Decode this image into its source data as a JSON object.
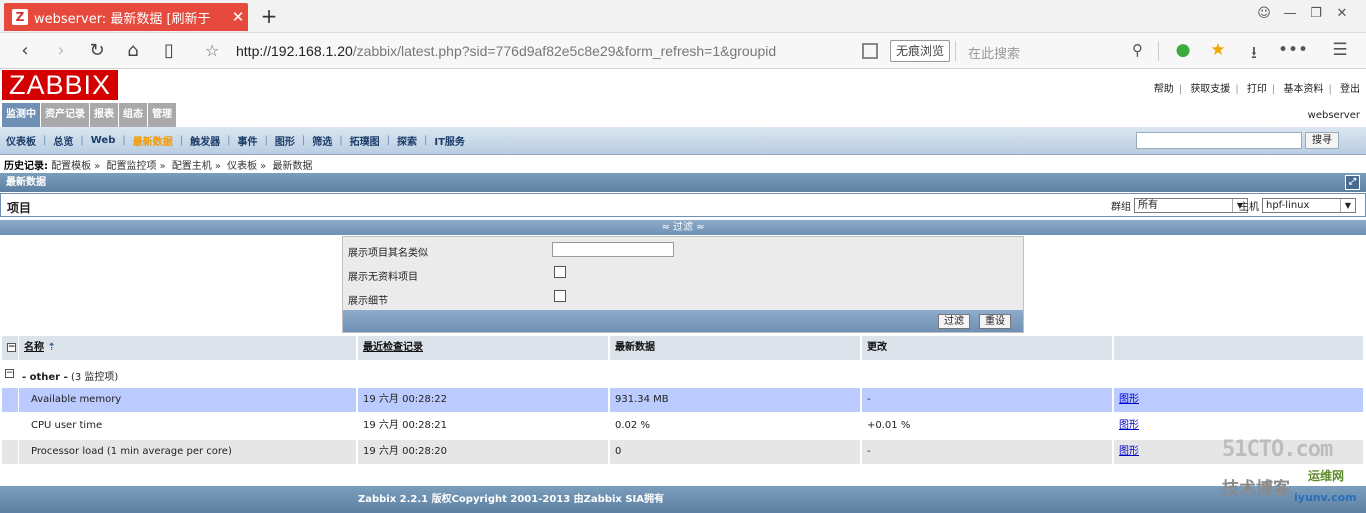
{
  "browser": {
    "tab_title": "webserver: 最新数据 [刷新于",
    "favicon_letter": "Z",
    "tab_close": "✕",
    "new_tab": "+",
    "url_host": "http://192.168.1.20",
    "url_rest": "/zabbix/latest.php?sid=776d9af82e5c8e29&form_refresh=1&groupid",
    "incognito_label": "无痕浏览",
    "search_placeholder": "在此搜索"
  },
  "header": {
    "logo": "ZABBIX",
    "links": [
      "帮助",
      "获取支援",
      "打印",
      "基本资料",
      "登出"
    ],
    "server_name": "webserver"
  },
  "main_menu": [
    {
      "label": "监测中",
      "active": true
    },
    {
      "label": "资产记录",
      "active": false
    },
    {
      "label": "报表",
      "active": false
    },
    {
      "label": "组态",
      "active": false
    },
    {
      "label": "管理",
      "active": false
    }
  ],
  "sub_menu": [
    {
      "label": "仪表板",
      "active": false
    },
    {
      "label": "总览",
      "active": false
    },
    {
      "label": "Web",
      "active": false
    },
    {
      "label": "最新数据",
      "active": true
    },
    {
      "label": "触发器",
      "active": false
    },
    {
      "label": "事件",
      "active": false
    },
    {
      "label": "图形",
      "active": false
    },
    {
      "label": "筛选",
      "active": false
    },
    {
      "label": "拓璞图",
      "active": false
    },
    {
      "label": "探索",
      "active": false
    },
    {
      "label": "IT服务",
      "active": false
    }
  ],
  "search_button": "搜寻",
  "history": {
    "label": "历史记录:",
    "items": [
      "配置模板",
      "配置监控项",
      "配置主机",
      "仪表板",
      "最新数据"
    ]
  },
  "section_title": "最新数据",
  "items_bar": {
    "title": "项目",
    "group_label": "群组",
    "group_value": "所有",
    "host_label": "主机",
    "host_value": "hpf-linux"
  },
  "filter": {
    "toggle": "≈ 过滤 ≈",
    "name_label": "展示项目其名类似",
    "no_data_label": "展示无资料项目",
    "details_label": "展示细节",
    "filter_button": "过滤",
    "reset_button": "重设"
  },
  "table": {
    "headers": [
      "名称",
      "最近检查记录",
      "最新数据",
      "更改",
      ""
    ],
    "group_label": "- other -",
    "group_count": "(3 监控项)",
    "rows": [
      {
        "name": "Available memory",
        "last_check": "19 六月 00:28:22",
        "last_value": "931.34 MB",
        "change": "-",
        "link": "图形"
      },
      {
        "name": "CPU user time",
        "last_check": "19 六月 00:28:21",
        "last_value": "0.02 %",
        "change": "+0.01 %",
        "link": "图形"
      },
      {
        "name": "Processor load (1 min average per core)",
        "last_check": "19 六月 00:28:20",
        "last_value": "0",
        "change": "-",
        "link": "图形"
      }
    ]
  },
  "footer": "Zabbix 2.2.1 版权Copyright 2001-2013 由Zabbix SIA拥有",
  "watermark": {
    "line1": "51CTO.com",
    "line2": "技术博客",
    "line3": "运维网",
    "line4": "iyunv.com"
  }
}
